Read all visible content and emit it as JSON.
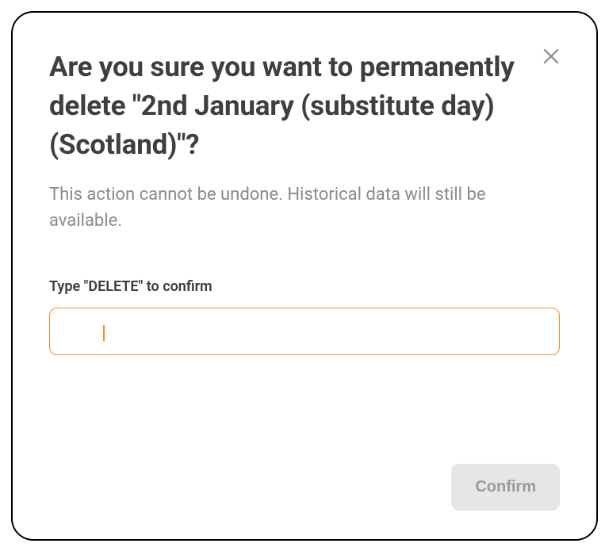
{
  "modal": {
    "title": "Are you sure you want to permanently delete \"2nd January (substitute day) (Scotland)\"?",
    "subtitle": "This action cannot be undone. Historical data will still be available.",
    "input_label": "Type \"DELETE\" to confirm",
    "input_value": "",
    "confirm_label": "Confirm"
  }
}
